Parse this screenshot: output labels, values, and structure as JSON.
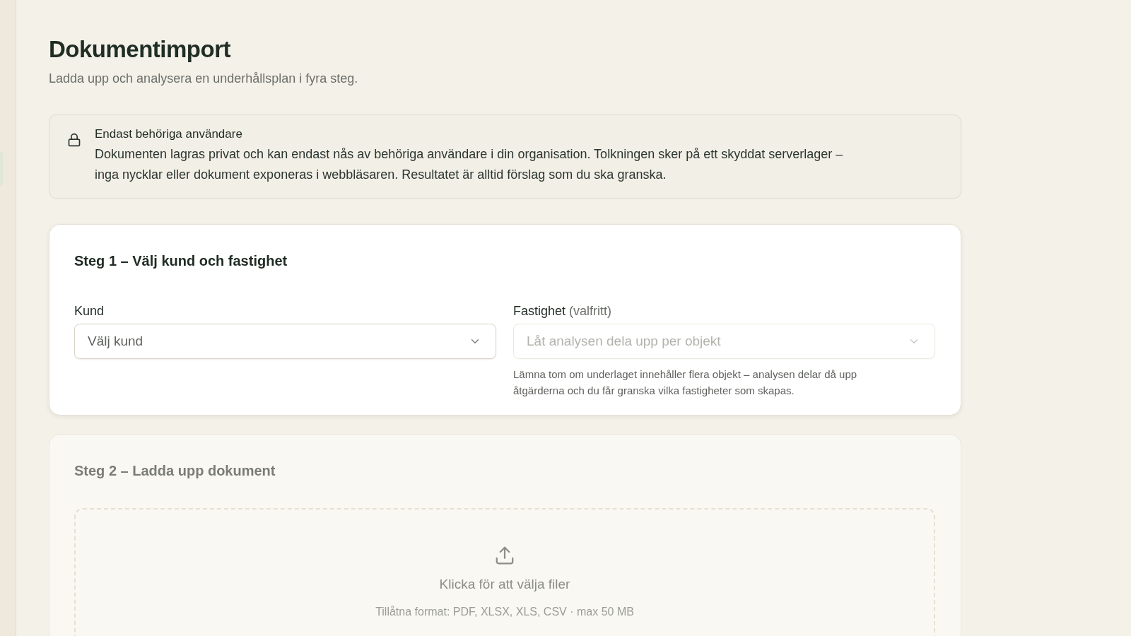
{
  "page": {
    "title": "Dokumentimport",
    "subtitle": "Ladda upp och analysera en underhållsplan i fyra steg."
  },
  "notice": {
    "title": "Endast behöriga användare",
    "body": "Dokumenten lagras privat och kan endast nås av behöriga användare i din organisation. Tolkningen sker på ett skyddat serverlager – inga nycklar eller dokument exponeras i webbläsaren. Resultatet är alltid förslag som du ska granska."
  },
  "steps": [
    {
      "kind": "fields",
      "title": "Steg 1 – Välj kund och fastighet",
      "disabled": false,
      "fields": [
        {
          "label": "Kund",
          "placeholder": "Välj kund",
          "disabled": false
        },
        {
          "label": "Fastighet",
          "note": "(valfritt)",
          "placeholder": "Låt analysen dela upp per objekt",
          "disabled": true,
          "hint": "Lämna tom om underlaget innehåller flera objekt – analysen delar då upp åtgärderna och du får granska vilka fastigheter som skapas."
        }
      ]
    },
    {
      "kind": "upload",
      "title": "Steg 2 – Ladda upp dokument",
      "disabled": true,
      "dropzone": {
        "prompt": "Klicka för att välja filer",
        "formats": "Tillåtna format: PDF, XLSX, XLS, CSV · max 50 MB"
      }
    }
  ]
}
